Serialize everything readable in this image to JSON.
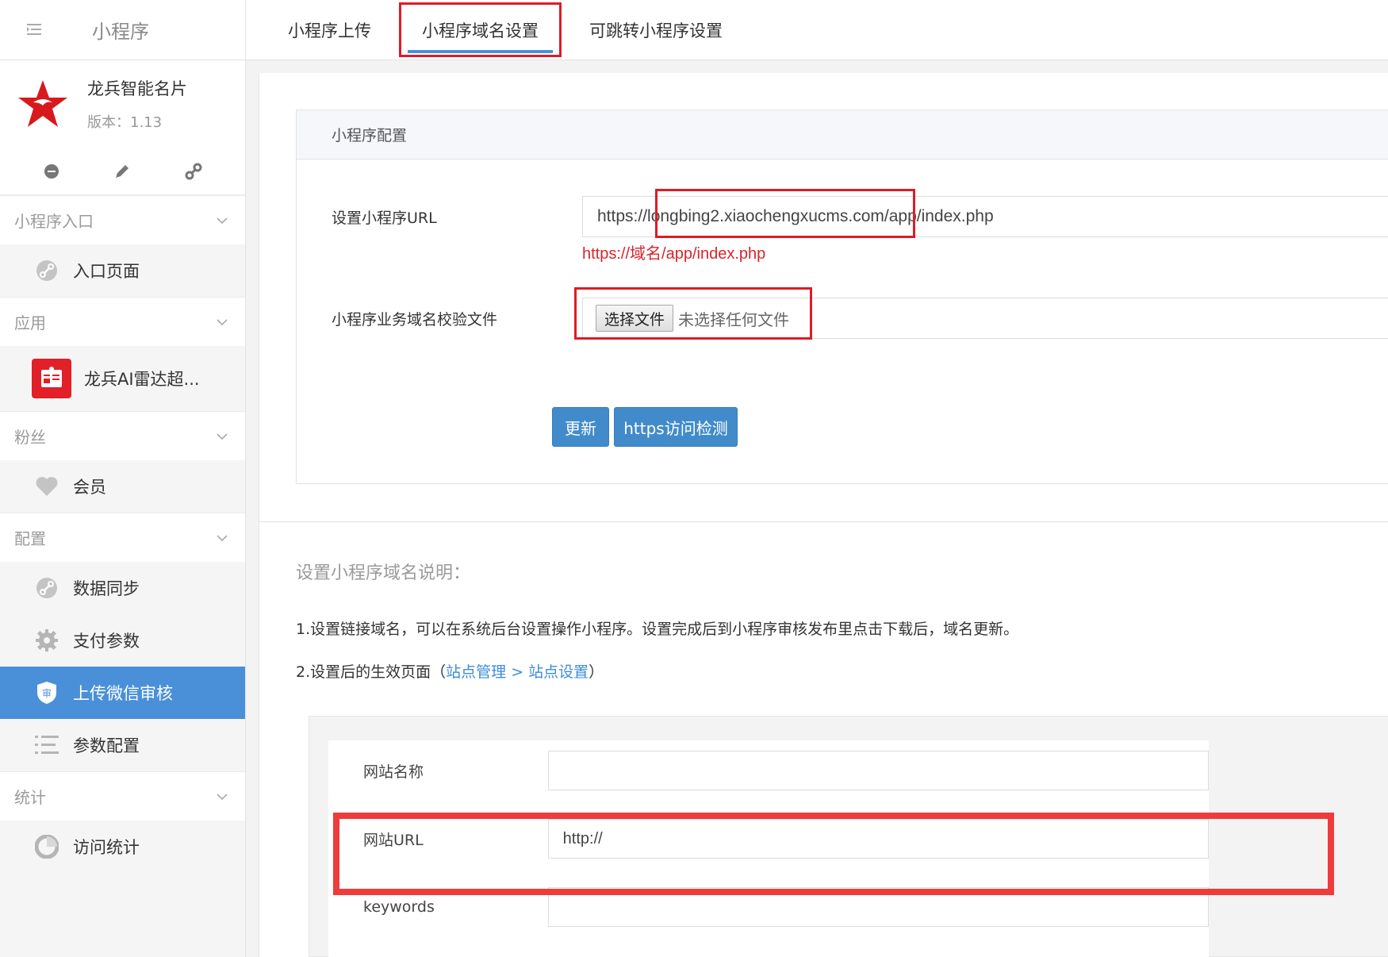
{
  "sidebar": {
    "title": "小程序",
    "app": {
      "name": "龙兵智能名片",
      "version": "版本：1.13"
    },
    "groups": [
      {
        "label": "小程序入口",
        "items": [
          {
            "label": "入口页面",
            "icon": "link-circle-icon"
          }
        ]
      },
      {
        "label": "应用",
        "items": [
          {
            "label": "龙兵AI雷达超...",
            "icon": "app-thumbnail-icon"
          }
        ]
      },
      {
        "label": "粉丝",
        "items": [
          {
            "label": "会员",
            "icon": "heart-icon"
          }
        ]
      },
      {
        "label": "配置",
        "items": [
          {
            "label": "数据同步",
            "icon": "link-circle-icon"
          },
          {
            "label": "支付参数",
            "icon": "gear-icon"
          },
          {
            "label": "上传微信审核",
            "icon": "shield-icon",
            "badge": "审",
            "active": true
          },
          {
            "label": "参数配置",
            "icon": "list-icon"
          }
        ]
      },
      {
        "label": "统计",
        "items": [
          {
            "label": "访问统计",
            "icon": "pie-chart-icon"
          }
        ]
      }
    ]
  },
  "tabs": [
    {
      "label": "小程序上传"
    },
    {
      "label": "小程序域名设置",
      "active": true
    },
    {
      "label": "可跳转小程序设置"
    }
  ],
  "config": {
    "heading": "小程序配置",
    "url_label": "设置小程序URL",
    "url_value": "https://longbing2.xiaochengxucms.com/app/index.php",
    "url_hint": "https://域名/app/index.php",
    "file_label": "小程序业务域名校验文件",
    "file_button": "选择文件",
    "file_status": "未选择任何文件",
    "update_button": "更新",
    "check_button": "https访问检测"
  },
  "notes": {
    "title": "设置小程序域名说明：",
    "line1": "1.设置链接域名，可以在系统后台设置操作小程序。设置完成后到小程序审核发布里点击下载后，域名更新。",
    "line2_prefix": "2.设置后的生效页面（",
    "link1": "站点管理",
    "sep": " > ",
    "link2": "站点设置",
    "line2_suffix": "）"
  },
  "demo_form": {
    "site_name_label": "网站名称",
    "site_name_value": "",
    "site_url_label": "网站URL",
    "site_url_value": "http://",
    "keywords_label": "keywords",
    "keywords_value": ""
  },
  "colors": {
    "accent": "#428bca",
    "highlight": "#e01b24",
    "hint": "#d8252b"
  }
}
